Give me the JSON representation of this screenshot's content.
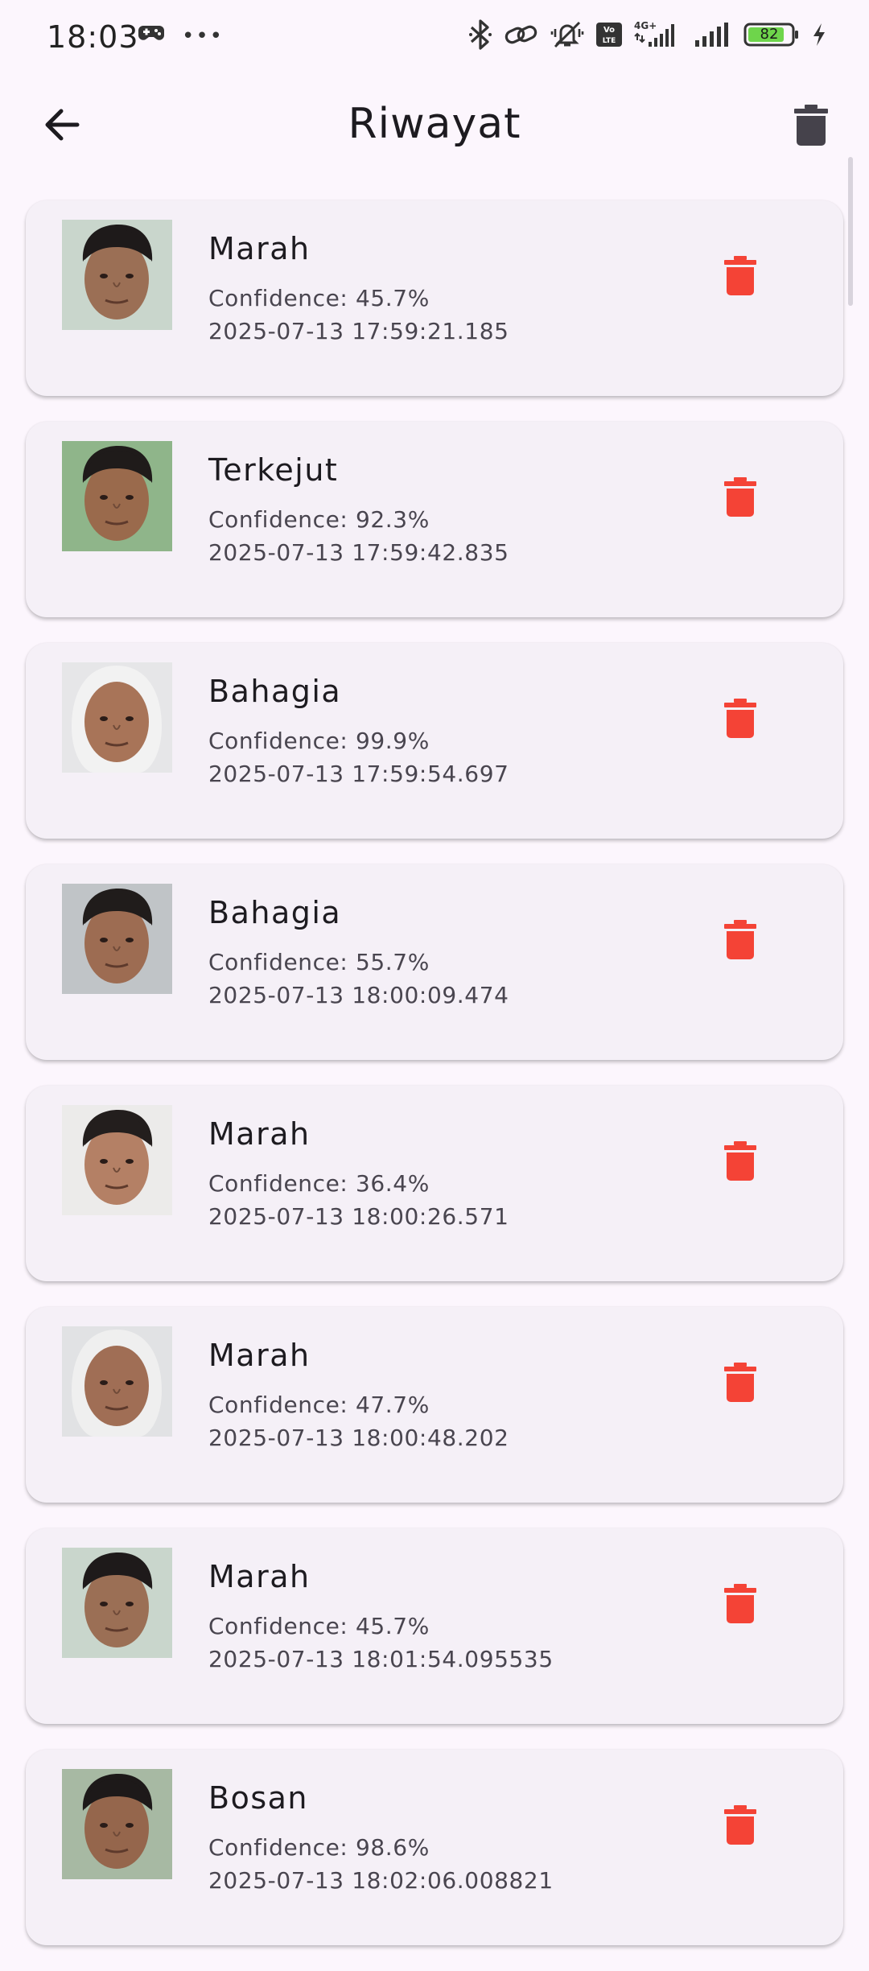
{
  "status_bar": {
    "time": "18:03",
    "more": "•••",
    "battery_level": "82",
    "network": "4G+",
    "volte": "Vo LTE",
    "icons": [
      "game-controller-icon",
      "bluetooth-icon",
      "link-icon",
      "vibrate-off-icon",
      "volte-icon",
      "signal-icon",
      "signal-icon-2",
      "battery-icon",
      "charging-icon"
    ]
  },
  "app_bar": {
    "title": "Riwayat",
    "back_icon": "arrow-back-icon",
    "clear_all_icon": "trash-icon"
  },
  "colors": {
    "background": "#fcf6fd",
    "card": "#f5f0f7",
    "delete_red": "#f44336",
    "app_icon": "#45424b"
  },
  "history": [
    {
      "label": "Marah",
      "confidence": "Confidence: 45.7%",
      "timestamp": "2025-07-13 17:59:21.185",
      "bg": "#c9d6cc",
      "skin": "#9b6f55",
      "hair": "#1e1a1a",
      "hijab": false
    },
    {
      "label": "Terkejut",
      "confidence": "Confidence: 92.3%",
      "timestamp": "2025-07-13 17:59:42.835",
      "bg": "#8fb58a",
      "skin": "#9a6a4c",
      "hair": "#1f1b1a",
      "hijab": false
    },
    {
      "label": "Bahagia",
      "confidence": "Confidence: 99.9%",
      "timestamp": "2025-07-13 17:59:54.697",
      "bg": "#e6e6e8",
      "skin": "#a87458",
      "hair": "#f2f2f2",
      "hijab": true
    },
    {
      "label": "Bahagia",
      "confidence": "Confidence: 55.7%",
      "timestamp": "2025-07-13 18:00:09.474",
      "bg": "#c0c4c7",
      "skin": "#9d6c52",
      "hair": "#201c1b",
      "hijab": false
    },
    {
      "label": "Marah",
      "confidence": "Confidence: 36.4%",
      "timestamp": "2025-07-13 18:00:26.571",
      "bg": "#ecebea",
      "skin": "#b48065",
      "hair": "#231e1d",
      "hijab": false
    },
    {
      "label": "Marah",
      "confidence": "Confidence: 47.7%",
      "timestamp": "2025-07-13 18:00:48.202",
      "bg": "#e1e2e4",
      "skin": "#a06e55",
      "hair": "#efefef",
      "hijab": true
    },
    {
      "label": "Marah",
      "confidence": "Confidence: 45.7%",
      "timestamp": "2025-07-13 18:01:54.095535",
      "bg": "#c9d6cc",
      "skin": "#9b6f55",
      "hair": "#1e1a1a",
      "hijab": false
    },
    {
      "label": "Bosan",
      "confidence": "Confidence: 98.6%",
      "timestamp": "2025-07-13 18:02:06.008821",
      "bg": "#a7b9a3",
      "skin": "#95664c",
      "hair": "#1d1919",
      "hijab": false
    }
  ]
}
